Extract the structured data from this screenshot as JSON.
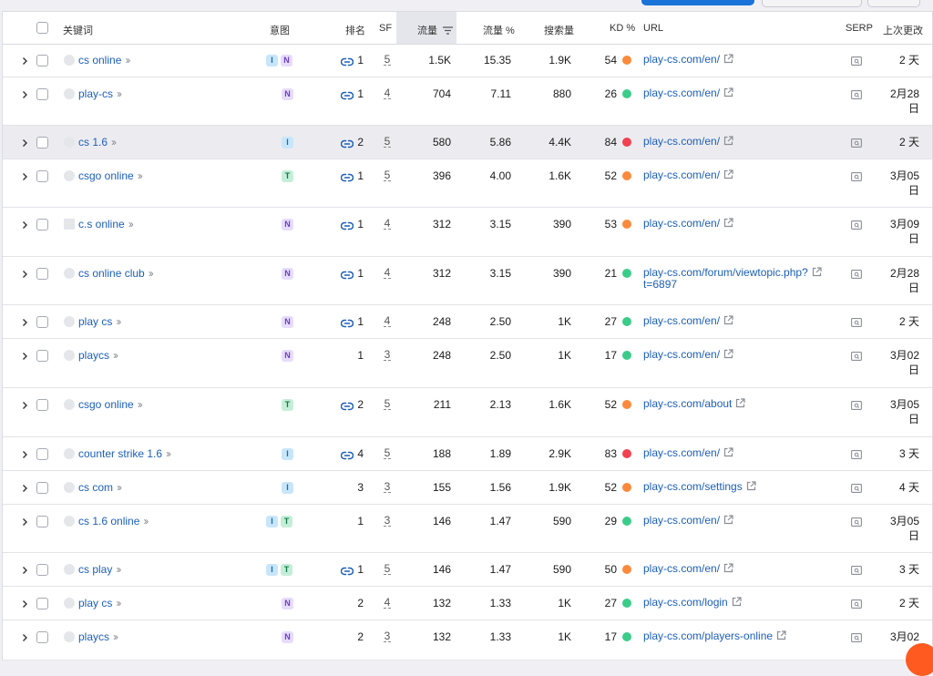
{
  "columns": {
    "keyword": "关键词",
    "intent": "意图",
    "position": "排名",
    "sf": "SF",
    "traffic": "流量",
    "traffic_pct": "流量 %",
    "volume": "搜索量",
    "kd": "KD %",
    "url": "URL",
    "serp": "SERP",
    "updated": "上次更改"
  },
  "colors": {
    "easy": "#3ccc8a",
    "medium": "#fb8a3c",
    "hard": "#f24150",
    "link": "#1c5fb8"
  },
  "rows": [
    {
      "keyword": "cs online",
      "intents": [
        "I",
        "N"
      ],
      "linked": true,
      "position": "1",
      "sf": "5",
      "traffic": "1.5K",
      "traffic_pct": "15.35",
      "volume": "1.9K",
      "kd": "54",
      "kd_level": "medium",
      "url": "play-cs.com/en/",
      "url2": "",
      "date": "2 天",
      "date2": "",
      "fav": "circle"
    },
    {
      "keyword": "play-cs",
      "intents": [
        "N"
      ],
      "linked": true,
      "position": "1",
      "sf": "4",
      "traffic": "704",
      "traffic_pct": "7.11",
      "volume": "880",
      "kd": "26",
      "kd_level": "easy",
      "url": "play-cs.com/en/",
      "url2": "",
      "date": "2月28",
      "date2": "日",
      "fav": "circle"
    },
    {
      "keyword": "cs 1.6",
      "intents": [
        "I"
      ],
      "linked": true,
      "position": "2",
      "sf": "5",
      "traffic": "580",
      "traffic_pct": "5.86",
      "volume": "4.4K",
      "kd": "84",
      "kd_level": "hard",
      "url": "play-cs.com/en/",
      "url2": "",
      "date": "2 天",
      "date2": "",
      "fav": "circle"
    },
    {
      "keyword": "csgo online",
      "intents": [
        "T"
      ],
      "linked": true,
      "position": "1",
      "sf": "5",
      "traffic": "396",
      "traffic_pct": "4.00",
      "volume": "1.6K",
      "kd": "52",
      "kd_level": "medium",
      "url": "play-cs.com/en/",
      "url2": "",
      "date": "3月05",
      "date2": "日",
      "fav": "circle"
    },
    {
      "keyword": "c.s online",
      "intents": [
        "N"
      ],
      "linked": true,
      "position": "1",
      "sf": "4",
      "traffic": "312",
      "traffic_pct": "3.15",
      "volume": "390",
      "kd": "53",
      "kd_level": "medium",
      "url": "play-cs.com/en/",
      "url2": "",
      "date": "3月09",
      "date2": "日",
      "fav": "square"
    },
    {
      "keyword": "cs online club",
      "intents": [
        "N"
      ],
      "linked": true,
      "position": "1",
      "sf": "4",
      "traffic": "312",
      "traffic_pct": "3.15",
      "volume": "390",
      "kd": "21",
      "kd_level": "easy",
      "url": "play-cs.com/forum/viewtopic.php?",
      "url2": "t=6897",
      "date": "2月28",
      "date2": "日",
      "fav": "circle"
    },
    {
      "keyword": "play cs",
      "intents": [
        "N"
      ],
      "linked": true,
      "position": "1",
      "sf": "4",
      "traffic": "248",
      "traffic_pct": "2.50",
      "volume": "1K",
      "kd": "27",
      "kd_level": "easy",
      "url": "play-cs.com/en/",
      "url2": "",
      "date": "2 天",
      "date2": "",
      "fav": "circle"
    },
    {
      "keyword": "playcs",
      "intents": [
        "N"
      ],
      "linked": false,
      "position": "1",
      "sf": "3",
      "traffic": "248",
      "traffic_pct": "2.50",
      "volume": "1K",
      "kd": "17",
      "kd_level": "easy",
      "url": "play-cs.com/en/",
      "url2": "",
      "date": "3月02",
      "date2": "日",
      "fav": "circle"
    },
    {
      "keyword": "csgo online",
      "intents": [
        "T"
      ],
      "linked": true,
      "position": "2",
      "sf": "5",
      "traffic": "211",
      "traffic_pct": "2.13",
      "volume": "1.6K",
      "kd": "52",
      "kd_level": "medium",
      "url": "play-cs.com/about",
      "url2": "",
      "date": "3月05",
      "date2": "日",
      "fav": "circle"
    },
    {
      "keyword": "counter strike 1.6",
      "intents": [
        "I"
      ],
      "linked": true,
      "position": "4",
      "sf": "5",
      "traffic": "188",
      "traffic_pct": "1.89",
      "volume": "2.9K",
      "kd": "83",
      "kd_level": "hard",
      "url": "play-cs.com/en/",
      "url2": "",
      "date": "3 天",
      "date2": "",
      "fav": "circle"
    },
    {
      "keyword": "cs com",
      "intents": [
        "I"
      ],
      "linked": false,
      "position": "3",
      "sf": "3",
      "traffic": "155",
      "traffic_pct": "1.56",
      "volume": "1.9K",
      "kd": "52",
      "kd_level": "medium",
      "url": "play-cs.com/settings",
      "url2": "",
      "date": "4 天",
      "date2": "",
      "fav": "circle"
    },
    {
      "keyword": "cs 1.6 online",
      "intents": [
        "I",
        "T"
      ],
      "linked": false,
      "position": "1",
      "sf": "3",
      "traffic": "146",
      "traffic_pct": "1.47",
      "volume": "590",
      "kd": "29",
      "kd_level": "easy",
      "url": "play-cs.com/en/",
      "url2": "",
      "date": "3月05",
      "date2": "日",
      "fav": "circle"
    },
    {
      "keyword": "cs play",
      "intents": [
        "I",
        "T"
      ],
      "linked": true,
      "position": "1",
      "sf": "5",
      "traffic": "146",
      "traffic_pct": "1.47",
      "volume": "590",
      "kd": "50",
      "kd_level": "medium",
      "url": "play-cs.com/en/",
      "url2": "",
      "date": "3 天",
      "date2": "",
      "fav": "circle"
    },
    {
      "keyword": "play cs",
      "intents": [
        "N"
      ],
      "linked": false,
      "position": "2",
      "sf": "4",
      "traffic": "132",
      "traffic_pct": "1.33",
      "volume": "1K",
      "kd": "27",
      "kd_level": "easy",
      "url": "play-cs.com/login",
      "url2": "",
      "date": "2 天",
      "date2": "",
      "fav": "circle"
    },
    {
      "keyword": "playcs",
      "intents": [
        "N"
      ],
      "linked": false,
      "position": "2",
      "sf": "3",
      "traffic": "132",
      "traffic_pct": "1.33",
      "volume": "1K",
      "kd": "17",
      "kd_level": "easy",
      "url": "play-cs.com/players-online",
      "url2": "",
      "date": "3月02",
      "date2": "",
      "fav": "circle"
    }
  ]
}
